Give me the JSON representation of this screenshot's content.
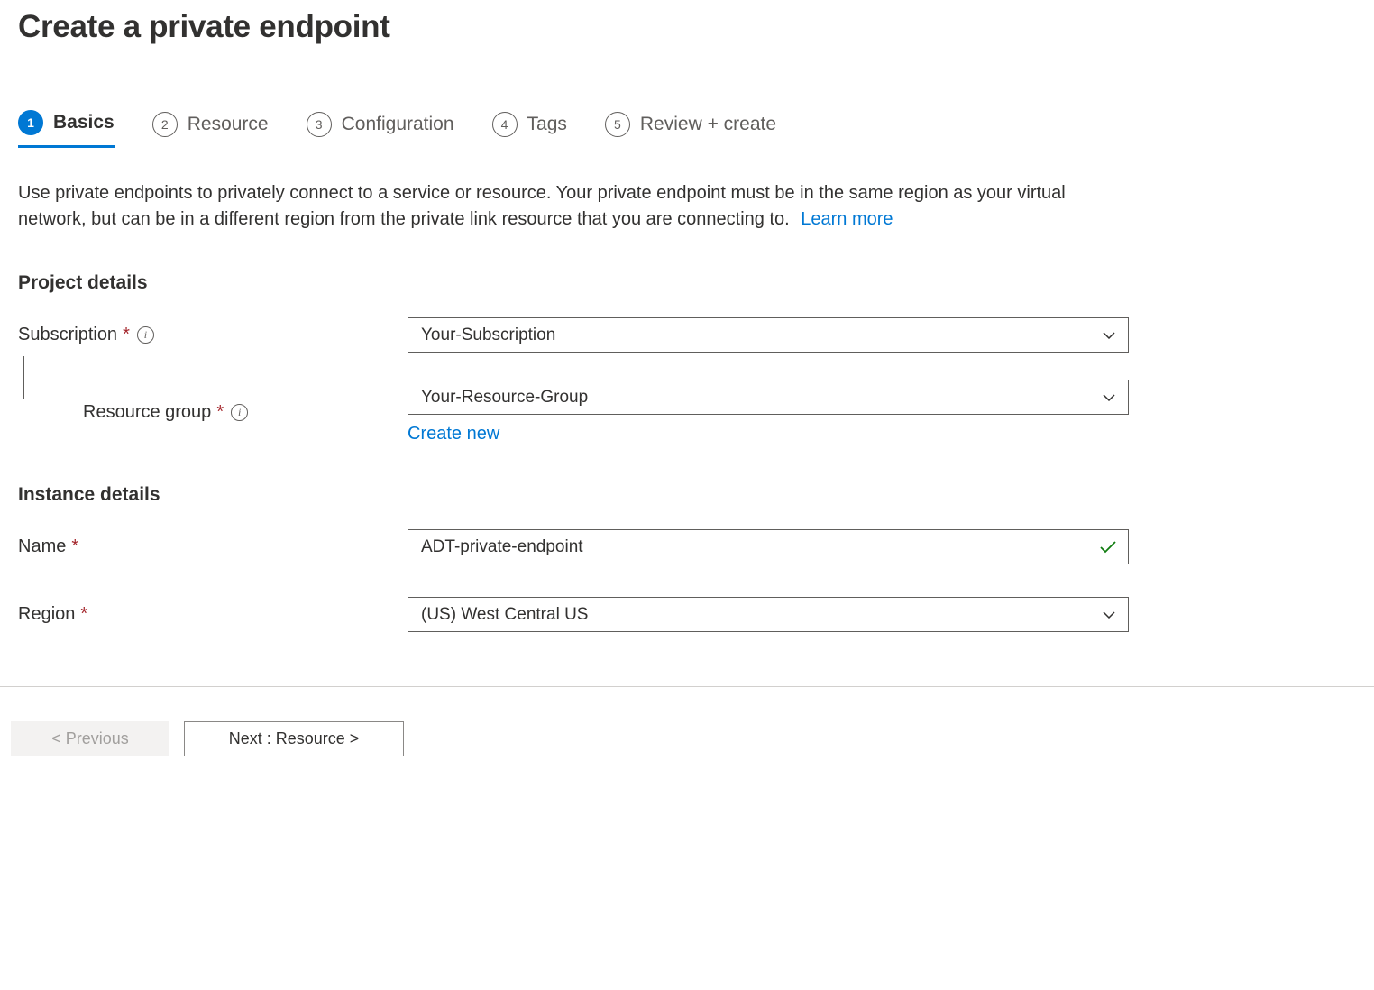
{
  "page": {
    "title": "Create a private endpoint"
  },
  "tabs": [
    {
      "num": "1",
      "label": "Basics",
      "active": true
    },
    {
      "num": "2",
      "label": "Resource",
      "active": false
    },
    {
      "num": "3",
      "label": "Configuration",
      "active": false
    },
    {
      "num": "4",
      "label": "Tags",
      "active": false
    },
    {
      "num": "5",
      "label": "Review + create",
      "active": false
    }
  ],
  "description": {
    "text": "Use private endpoints to privately connect to a service or resource. Your private endpoint must be in the same region as your virtual network, but can be in a different region from the private link resource that you are connecting to.",
    "learn_more": "Learn more"
  },
  "sections": {
    "project": {
      "title": "Project details",
      "subscription": {
        "label": "Subscription",
        "value": "Your-Subscription"
      },
      "resource_group": {
        "label": "Resource group",
        "value": "Your-Resource-Group",
        "create_new": "Create new"
      }
    },
    "instance": {
      "title": "Instance details",
      "name": {
        "label": "Name",
        "value": "ADT-private-endpoint"
      },
      "region": {
        "label": "Region",
        "value": "(US) West Central US"
      }
    }
  },
  "footer": {
    "previous": "< Previous",
    "next": "Next : Resource >"
  }
}
